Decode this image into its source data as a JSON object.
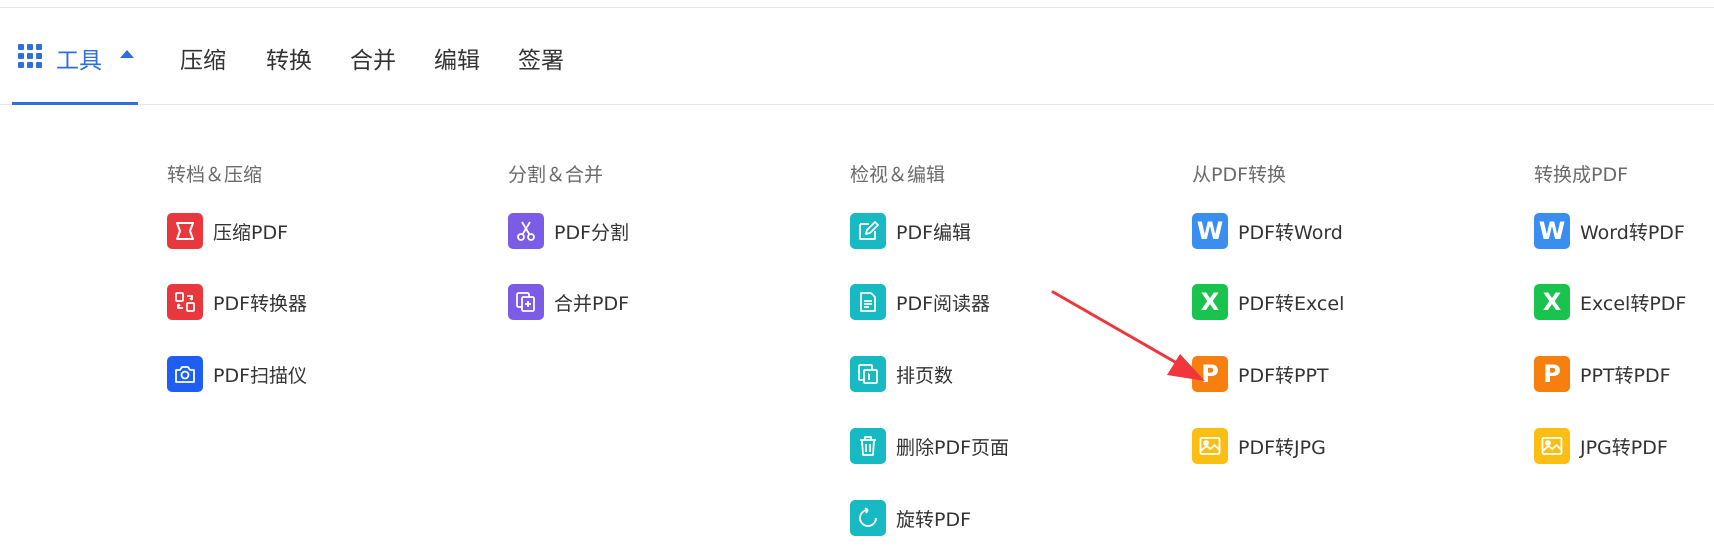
{
  "nav": {
    "tools_label": "工具",
    "links": [
      "压缩",
      "转换",
      "合并",
      "编辑",
      "签署"
    ]
  },
  "colors": {
    "accent": "#2f6fdb",
    "red": "#e8383d",
    "blue": "#1f5ef2",
    "purple": "#7b5ce6",
    "teal": "#17b9c2",
    "word": "#3a8ef0",
    "excel": "#19c34d",
    "orange": "#f77f0f",
    "yellow": "#fbbf14",
    "annotation_arrow": "#f0353c"
  },
  "columns": [
    {
      "heading": "转档＆压缩",
      "items": [
        {
          "label": "压缩PDF",
          "icon": "compress-icon"
        },
        {
          "label": "PDF转换器",
          "icon": "converter-icon"
        },
        {
          "label": "PDF扫描仪",
          "icon": "camera-icon"
        }
      ]
    },
    {
      "heading": "分割＆合并",
      "items": [
        {
          "label": "PDF分割",
          "icon": "scissors-icon"
        },
        {
          "label": "合并PDF",
          "icon": "merge-icon"
        }
      ]
    },
    {
      "heading": "检视＆编辑",
      "items": [
        {
          "label": "PDF编辑",
          "icon": "edit-icon"
        },
        {
          "label": "PDF阅读器",
          "icon": "reader-icon"
        },
        {
          "label": "排页数",
          "icon": "page-number-icon"
        },
        {
          "label": "删除PDF页面",
          "icon": "trash-icon"
        },
        {
          "label": "旋转PDF",
          "icon": "rotate-icon"
        }
      ]
    },
    {
      "heading": "从PDF转换",
      "items": [
        {
          "label": "PDF转Word",
          "icon": "word-icon",
          "letter": "W"
        },
        {
          "label": "PDF转Excel",
          "icon": "excel-icon",
          "letter": "X"
        },
        {
          "label": "PDF转PPT",
          "icon": "ppt-icon",
          "letter": "P"
        },
        {
          "label": "PDF转JPG",
          "icon": "image-icon"
        }
      ]
    },
    {
      "heading": "转换成PDF",
      "items": [
        {
          "label": "Word转PDF",
          "icon": "word-icon",
          "letter": "W"
        },
        {
          "label": "Excel转PDF",
          "icon": "excel-icon",
          "letter": "X"
        },
        {
          "label": "PPT转PDF",
          "icon": "ppt-icon",
          "letter": "P"
        },
        {
          "label": "JPG转PDF",
          "icon": "image-icon"
        }
      ]
    }
  ]
}
